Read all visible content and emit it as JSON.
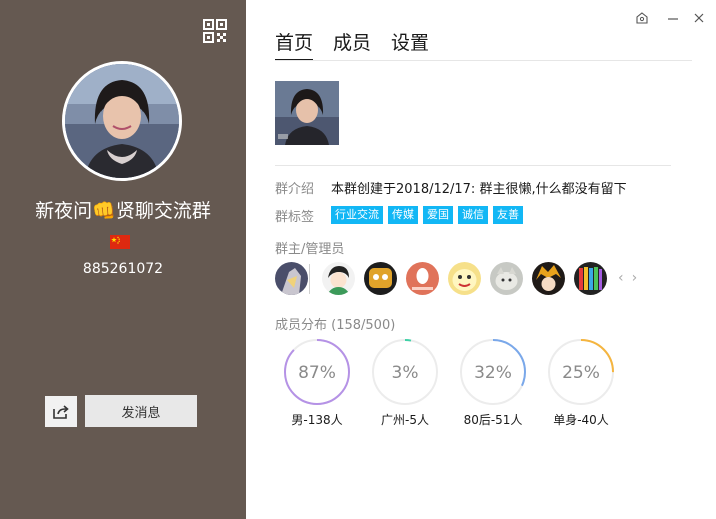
{
  "left_panel": {
    "group_name": "新夜问👊贤聊交流群",
    "group_id": "885261072",
    "send_message_label": "发消息",
    "bg_color": "#655951"
  },
  "tabs": [
    {
      "label": "首页"
    },
    {
      "label": "成员"
    },
    {
      "label": "设置"
    }
  ],
  "info": {
    "intro_label": "群介绍",
    "intro_text": "本群创建于2018/12/17:  群主很懒,什么都没有留下",
    "tags_label": "群标签",
    "tags": [
      "行业交流",
      "传媒",
      "爱国",
      "诚信",
      "友善"
    ],
    "admins_label": "群主/管理员"
  },
  "distribution": {
    "title": "成员分布 (158/500)",
    "items": [
      {
        "percent_text": "87%",
        "value": 0.87,
        "label": "男-138人",
        "color": "#b592e6"
      },
      {
        "percent_text": "3%",
        "value": 0.03,
        "label": "广州-5人",
        "color": "#3fd1a7"
      },
      {
        "percent_text": "32%",
        "value": 0.32,
        "label": "80后-51人",
        "color": "#7aa8ea"
      },
      {
        "percent_text": "25%",
        "value": 0.25,
        "label": "单身-40人",
        "color": "#f5b53f"
      }
    ]
  },
  "accent_color": "#12b7f5"
}
